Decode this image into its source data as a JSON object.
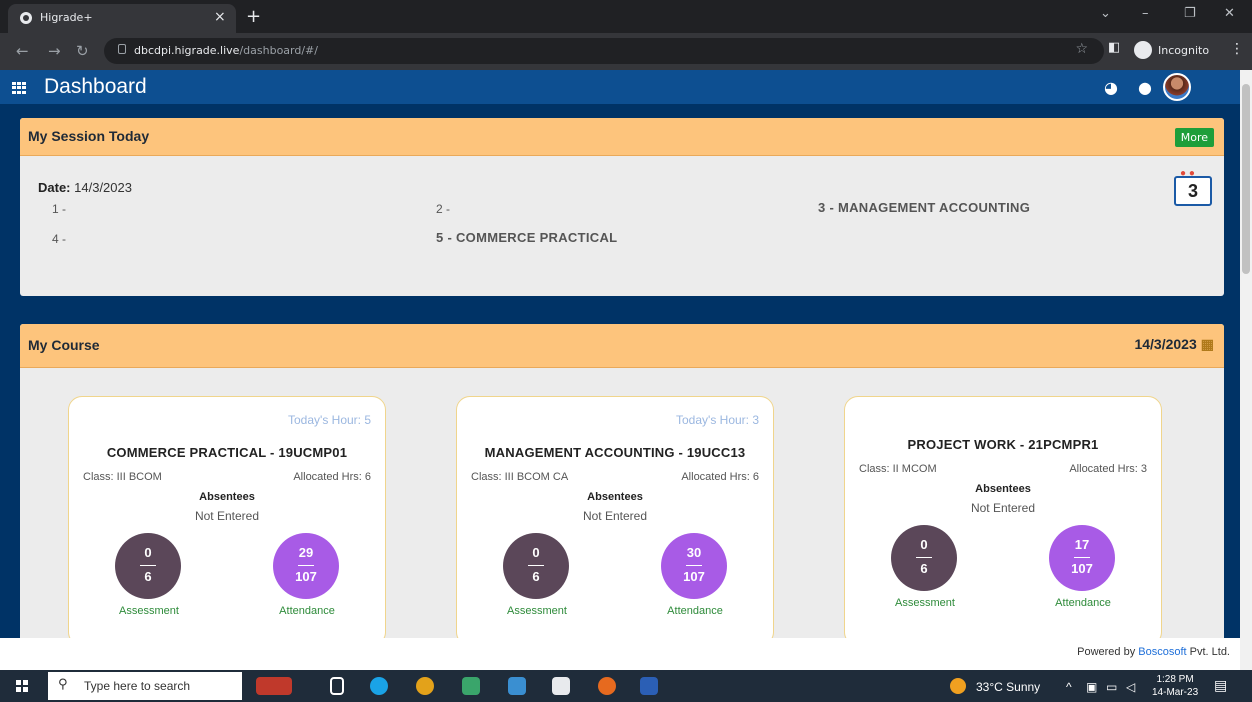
{
  "browser": {
    "tab_title": "Higrade+",
    "tab_close": "×",
    "new_tab": "+",
    "url_host": "dbcdpi.higrade.live",
    "url_path": "/dashboard/#/",
    "incognito_label": "Incognito",
    "window_min": "–",
    "window_restore": "❐",
    "window_close": "✕",
    "chevron": "⌄",
    "kebab": "⋮"
  },
  "app": {
    "title": "Dashboard"
  },
  "session": {
    "header": "My Session Today",
    "more_label": "More",
    "date_label": "Date:",
    "date_value": "14/3/2023",
    "calendar_day": "3",
    "slots": [
      "1 -",
      "2 -",
      "3 - MANAGEMENT ACCOUNTING",
      "4 -",
      "5 - COMMERCE PRACTICAL"
    ]
  },
  "course": {
    "header": "My Course",
    "date": "14/3/2023",
    "cards": [
      {
        "hour": "Today's Hour: 5",
        "title": "COMMERCE PRACTICAL - 19UCMP01",
        "class": "Class: III BCOM",
        "alloc": "Allocated Hrs: 6",
        "absentees": "Absentees",
        "not_entered": "Not Entered",
        "assess_num": "0",
        "assess_den": "6",
        "att_num": "29",
        "att_den": "107",
        "assess_label": "Assessment",
        "att_label": "Attendance"
      },
      {
        "hour": "Today's Hour: 3",
        "title": "MANAGEMENT ACCOUNTING - 19UCC13",
        "class": "Class: III BCOM CA",
        "alloc": "Allocated Hrs: 6",
        "absentees": "Absentees",
        "not_entered": "Not Entered",
        "assess_num": "0",
        "assess_den": "6",
        "att_num": "30",
        "att_den": "107",
        "assess_label": "Assessment",
        "att_label": "Attendance"
      },
      {
        "hour": "",
        "title": "PROJECT WORK - 21PCMPR1",
        "class": "Class: II MCOM",
        "alloc": "Allocated Hrs: 3",
        "absentees": "Absentees",
        "not_entered": "Not Entered",
        "assess_num": "0",
        "assess_den": "6",
        "att_num": "17",
        "att_den": "107",
        "assess_label": "Assessment",
        "att_label": "Attendance"
      }
    ]
  },
  "footer": {
    "powered_by": "Powered by ",
    "company": "Boscosoft",
    "suffix": " Pvt. Ltd."
  },
  "taskbar": {
    "search_placeholder": "Type here to search",
    "weather": "33°C  Sunny",
    "time": "1:28 PM",
    "date": "14-Mar-23"
  },
  "colors": {
    "app_bar": "#0d4f91",
    "panel_header": "#fdc47c",
    "assessment": "#5b4759",
    "attendance": "#a85be6",
    "more_button": "#1e9e3a"
  }
}
